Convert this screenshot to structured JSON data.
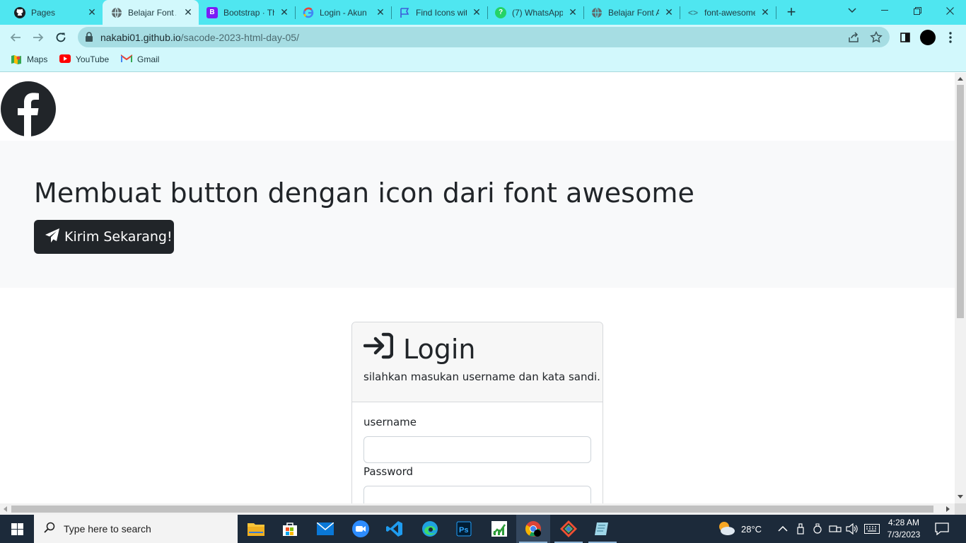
{
  "browser": {
    "tabs": [
      {
        "title": "Pages",
        "icon": "github-icon",
        "active": false
      },
      {
        "title": "Belajar Font Awesome",
        "icon": "globe-icon",
        "active": true
      },
      {
        "title": "Bootstrap · The",
        "icon": "bootstrap-icon",
        "active": false
      },
      {
        "title": "Login - Akun",
        "icon": "google-icon",
        "active": false
      },
      {
        "title": "Find Icons wit",
        "icon": "flag-icon",
        "active": false
      },
      {
        "title": "(7) WhatsApp",
        "icon": "whatsapp-icon",
        "active": false
      },
      {
        "title": "Belajar Font Awesome",
        "icon": "globe-icon",
        "active": false
      },
      {
        "title": "font-awesome",
        "icon": "code-icon",
        "active": false
      }
    ],
    "url_host": "nakabi01.github.io",
    "url_path": "/sacode-2023-html-day-05/",
    "bookmarks": [
      {
        "label": "Maps",
        "icon": "maps-icon"
      },
      {
        "label": "YouTube",
        "icon": "youtube-icon"
      },
      {
        "label": "Gmail",
        "icon": "gmail-icon"
      }
    ],
    "colors": {
      "tabstrip": "#4fe6f0",
      "toolbar": "#d2f8fc",
      "omnibox": "#a6dde3"
    }
  },
  "page": {
    "hero_title": "Membuat button dengan icon dari font awesome",
    "send_button_label": "Kirim Sekarang!",
    "login": {
      "title": "Login",
      "subtitle": "silahkan masukan username dan kata sandi.",
      "username_label": "username",
      "password_label": "Password",
      "username_value": "",
      "password_value": ""
    },
    "colors": {
      "dark": "#212529",
      "hero_bg": "#f8f9fa"
    }
  },
  "taskbar": {
    "search_placeholder": "Type here to search",
    "weather": "28°C",
    "time": "4:28 AM",
    "date": "7/3/2023",
    "apps": [
      "file-explorer-icon",
      "store-icon",
      "mail-icon",
      "zoom-icon",
      "vscode-icon",
      "edge-icon",
      "photoshop-icon",
      "stocks-icon",
      "chrome-icon",
      "git-icon",
      "notepad-icon"
    ]
  }
}
